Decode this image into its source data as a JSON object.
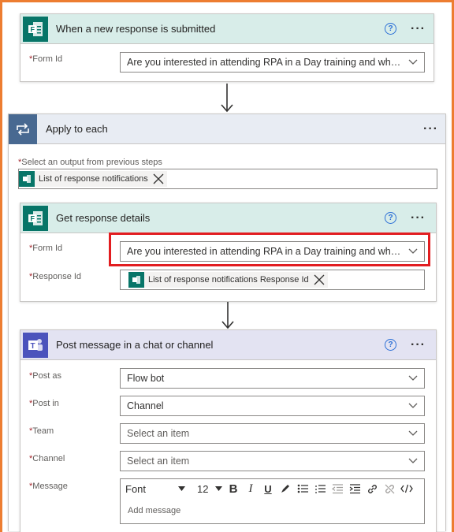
{
  "trigger": {
    "title": "When a new response is submitted",
    "form_id_label": "Form Id",
    "form_id_value": "Are you interested in attending RPA in a Day training and what ..."
  },
  "apply_each": {
    "title": "Apply to each",
    "select_label": "Select an output from previous steps",
    "token_label": "List of response notifications"
  },
  "get_details": {
    "title": "Get response details",
    "form_id_label": "Form Id",
    "form_id_value": "Are you interested in attending RPA in a Day training and what ...",
    "response_id_label": "Response Id",
    "response_id_token": "List of response notifications Response Id"
  },
  "post_message": {
    "title": "Post message in a chat or channel",
    "post_as_label": "Post as",
    "post_as_value": "Flow bot",
    "post_in_label": "Post in",
    "post_in_value": "Channel",
    "team_label": "Team",
    "team_placeholder": "Select an item",
    "channel_label": "Channel",
    "channel_placeholder": "Select an item",
    "message_label": "Message",
    "message_placeholder": "Add message",
    "toolbar": {
      "font": "Font",
      "size": "12",
      "bold": "B",
      "italic": "I",
      "underline": "U"
    }
  },
  "common": {
    "required_marker": "*",
    "help": "?",
    "more": "···"
  },
  "colors": {
    "frame": "#ed7d31",
    "highlight": "#e21d20",
    "forms": "#077568",
    "loop": "#486991",
    "teams": "#4b53bc"
  }
}
